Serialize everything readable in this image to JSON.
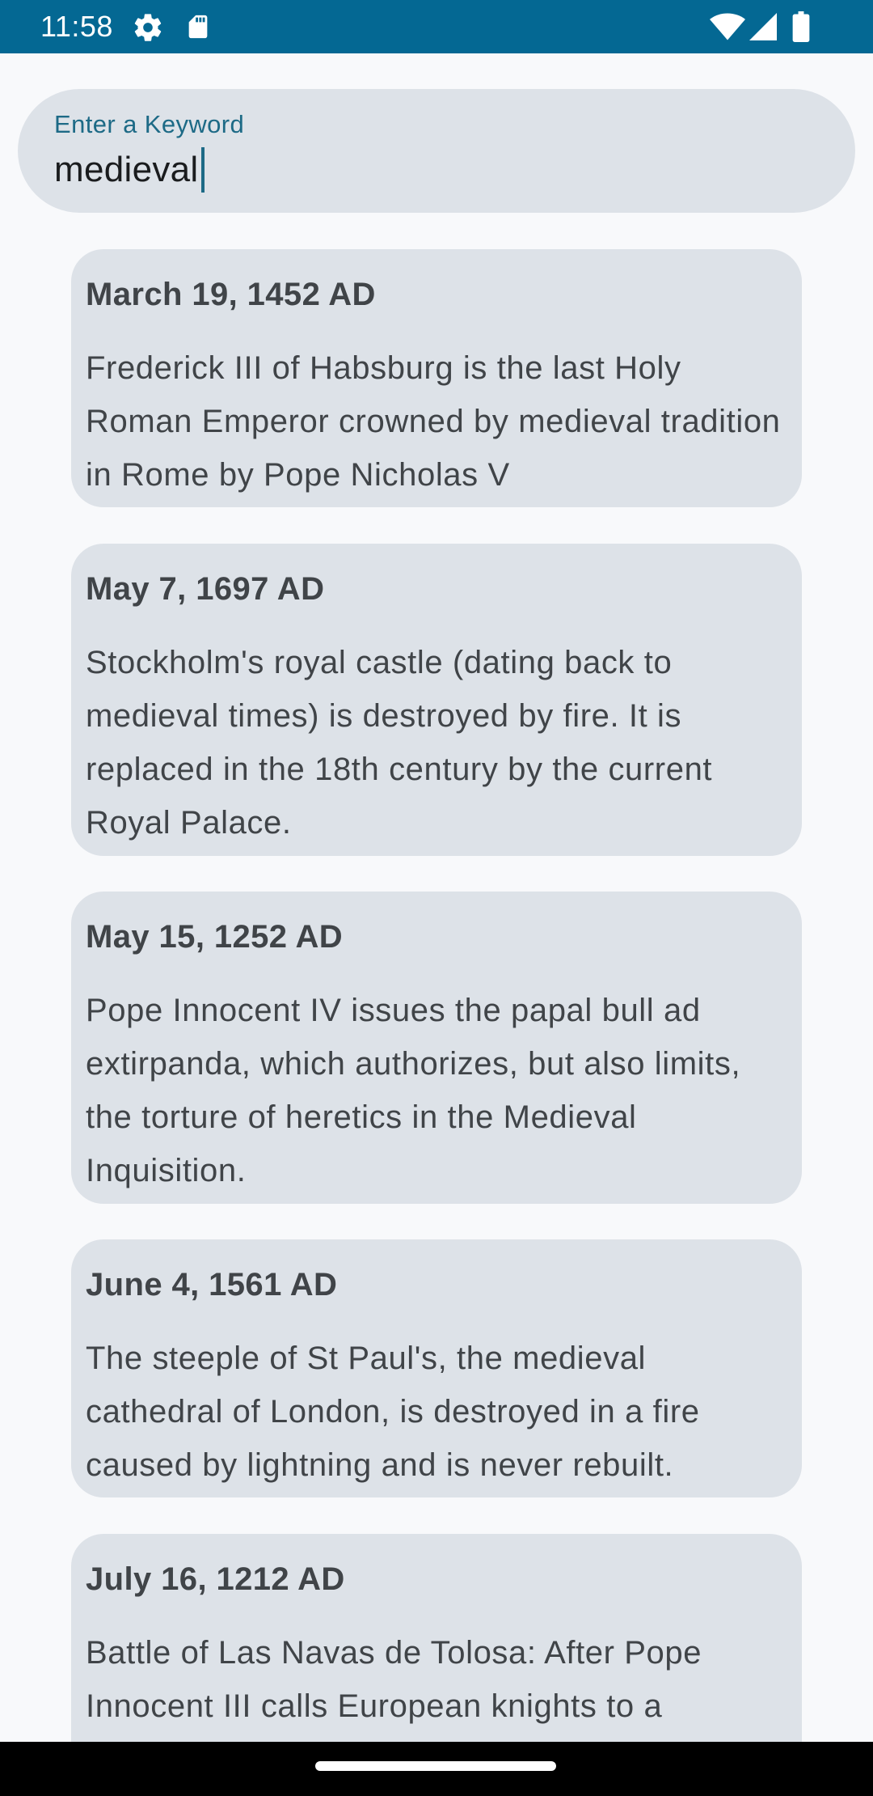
{
  "status_bar": {
    "time": "11:58",
    "icons": [
      "gear-icon",
      "sd-card-icon",
      "wifi-icon",
      "signal-icon",
      "battery-icon"
    ],
    "background": "#046893"
  },
  "search": {
    "label": "Enter a Keyword",
    "value": "medieval"
  },
  "events": [
    {
      "date": "March 19, 1452 AD",
      "description": "Frederick III of Habsburg is the last Holy Roman Emperor crowned by medieval tradition in Rome by Pope Nicholas V"
    },
    {
      "date": "May 7, 1697 AD",
      "description": "Stockholm's royal castle (dating back to medieval times) is destroyed by fire. It is replaced in the 18th century by the current Royal Palace."
    },
    {
      "date": "May 15, 1252 AD",
      "description": "Pope Innocent IV issues the papal bull ad extirpanda, which authorizes, but also limits, the torture of heretics in the Medieval Inquisition."
    },
    {
      "date": "June 4, 1561 AD",
      "description": "The steeple of St Paul's, the medieval cathedral of London, is destroyed in a fire caused by lightning and is never rebuilt."
    },
    {
      "date": "July 16, 1212 AD",
      "description": "Battle of Las Navas de Tolosa: After Pope Innocent III calls European knights to a"
    }
  ],
  "colors": {
    "card_background": "#dde2e8",
    "accent": "#1d6a86"
  }
}
